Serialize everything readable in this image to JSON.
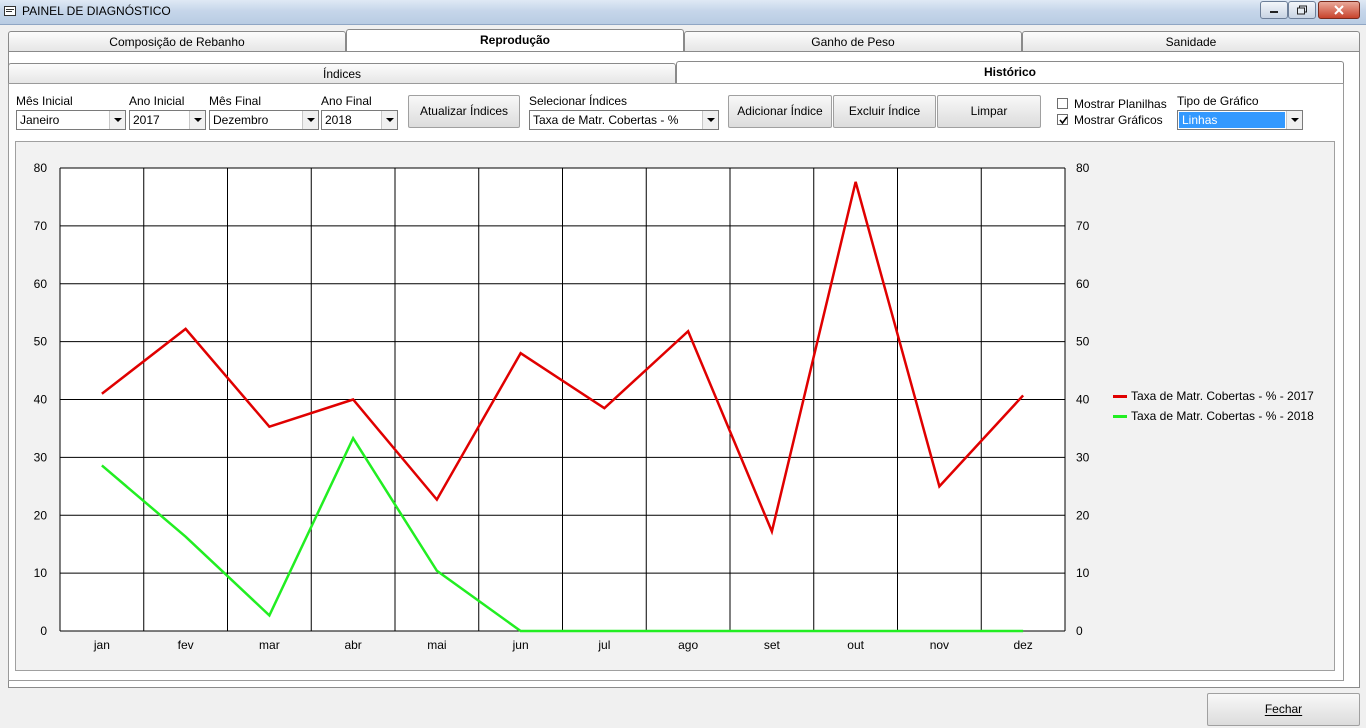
{
  "window": {
    "title": "PAINEL DE DIAGNÓSTICO"
  },
  "main_tabs": [
    {
      "label": "Composição de Rebanho",
      "active": false
    },
    {
      "label": "Reprodução",
      "active": true
    },
    {
      "label": "Ganho de Peso",
      "active": false
    },
    {
      "label": "Sanidade",
      "active": false
    }
  ],
  "sub_tabs": [
    {
      "label": "Índices",
      "active": false
    },
    {
      "label": "Histórico",
      "active": true
    }
  ],
  "filters": {
    "mes_inicial": {
      "label": "Mês Inicial",
      "value": "Janeiro"
    },
    "ano_inicial": {
      "label": "Ano Inicial",
      "value": "2017"
    },
    "mes_final": {
      "label": "Mês Final",
      "value": "Dezembro"
    },
    "ano_final": {
      "label": "Ano Final",
      "value": "2018"
    },
    "atualizar_label": "Atualizar Índices",
    "selecionar": {
      "label": "Selecionar Índices",
      "value": "Taxa de Matr. Cobertas - %"
    },
    "adicionar_label": "Adicionar Índice",
    "excluir_label": "Excluir Índice",
    "limpar_label": "Limpar",
    "mostrar_planilhas": {
      "label": "Mostrar Planilhas",
      "checked": false
    },
    "mostrar_graficos": {
      "label": "Mostrar Gráficos",
      "checked": true
    },
    "tipo_grafico": {
      "label": "Tipo de Gráfico",
      "value": "Linhas"
    }
  },
  "footer": {
    "fechar_label": "Fechar"
  },
  "colors": {
    "series_2017": "#e00000",
    "series_2018": "#22ee22",
    "selection": "#3399ff"
  },
  "chart_data": {
    "type": "line",
    "categories": [
      "jan",
      "fev",
      "mar",
      "abr",
      "mai",
      "jun",
      "jul",
      "ago",
      "set",
      "out",
      "nov",
      "dez"
    ],
    "series": [
      {
        "name": "Taxa de Matr. Cobertas - % - 2017",
        "values": [
          41,
          52.2,
          35.3,
          40,
          22.7,
          48,
          38.5,
          51.8,
          17.2,
          77.6,
          25,
          40.7
        ]
      },
      {
        "name": "Taxa de Matr. Cobertas - % - 2018",
        "values": [
          28.6,
          16.3,
          2.7,
          33.3,
          10.4,
          0,
          0,
          0,
          0,
          0,
          0,
          0
        ]
      }
    ],
    "ylim": [
      0,
      80
    ],
    "yticks": [
      0,
      10,
      20,
      30,
      40,
      50,
      60,
      70,
      80
    ],
    "grid": true,
    "legend": "right"
  }
}
